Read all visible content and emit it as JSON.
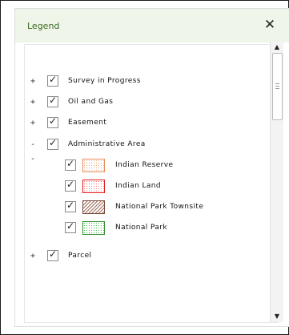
{
  "legend": {
    "title": "Legend",
    "close_icon": "close-icon",
    "close_glyph": "✕"
  },
  "tree": {
    "layers": [
      {
        "toggle": "+",
        "label": "Survey in Progress",
        "checked": true
      },
      {
        "toggle": "+",
        "label": "Oil and Gas",
        "checked": true
      },
      {
        "toggle": "+",
        "label": "Easement",
        "checked": true
      },
      {
        "toggle": "--",
        "label": "Administrative Area",
        "checked": true,
        "children": [
          {
            "label": "Indian Reserve",
            "checked": true,
            "swatch_color": "#e88b5a"
          },
          {
            "label": "Indian Land",
            "checked": true,
            "swatch_color": "#e11a1a"
          },
          {
            "label": "National Park Townsite",
            "checked": true,
            "swatch_color": "#7a4a3a"
          },
          {
            "label": "National Park",
            "checked": true,
            "swatch_color": "#2f8f2f"
          }
        ]
      },
      {
        "toggle": "+",
        "label": "Parcel",
        "checked": true
      }
    ]
  },
  "scrollbar": {
    "up_glyph": "▲",
    "down_glyph": "▼"
  }
}
